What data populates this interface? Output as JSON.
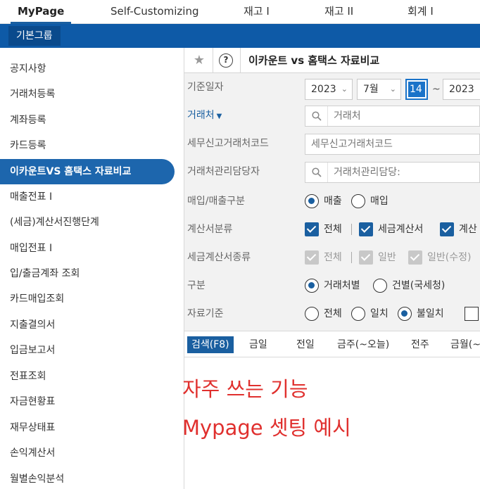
{
  "topnav": {
    "tabs": [
      {
        "label": "MyPage",
        "active": true
      },
      {
        "label": "Self-Customizing"
      },
      {
        "label": "재고 I"
      },
      {
        "label": "재고 II"
      },
      {
        "label": "회계 I"
      }
    ]
  },
  "groupbar": {
    "group_label": "기본그룹"
  },
  "sidebar": {
    "items": [
      "공지사항",
      "거래처등록",
      "계좌등록",
      "카드등록",
      "이카운트VS 홈택스 자료비교",
      "매출전표 I",
      "(세금)계산서진행단계",
      "매입전표 I",
      "입/출금계좌 조회",
      "카드매입조회",
      "지출결의서",
      "입금보고서",
      "전표조회",
      "자금현황표",
      "재무상태표",
      "손익계산서",
      "월별손익분석"
    ]
  },
  "titlebar": {
    "title": "이카운트 vs 홈택스 자료비교",
    "help_glyph": "?"
  },
  "form": {
    "base_date": {
      "label": "기준일자",
      "year": "2023",
      "month": "7월",
      "day": "14",
      "tilde": "~",
      "end_year": "2023"
    },
    "customer": {
      "label": "거래처",
      "placeholder": "거래처"
    },
    "tax_customer_code": {
      "label": "세무신고거래처코드",
      "placeholder": "세무신고거래처코드"
    },
    "customer_manager": {
      "label": "거래처관리담당자",
      "placeholder": "거래처관리담당:"
    },
    "buy_sell": {
      "label": "매입/매출구분",
      "options": [
        "매출",
        "매입"
      ],
      "selected": "매출"
    },
    "invoice_class": {
      "label": "계산서분류",
      "options": [
        "전체",
        "세금계산서",
        "계산"
      ]
    },
    "tax_invoice_type": {
      "label": "세금계산서종류",
      "options": [
        "전체",
        "일반",
        "일반(수정)"
      ]
    },
    "division": {
      "label": "구분",
      "options": [
        "거래처별",
        "건별(국세청)"
      ],
      "selected": "거래처별"
    },
    "data_basis": {
      "label": "자료기준",
      "options": [
        "전체",
        "일치",
        "불일치"
      ],
      "selected": "불일치"
    }
  },
  "quickbar": {
    "buttons": [
      "검색(F8)",
      "금일",
      "전일",
      "금주(~오늘)",
      "전주",
      "금월(~"
    ]
  },
  "notes": {
    "line1": "자주 쓰는 기능",
    "line2": "Mypage 셋팅 예시"
  },
  "colors": {
    "brand_blue": "#0e5aa7",
    "accent": "#1a5fa0",
    "note_red": "#e0302e"
  }
}
